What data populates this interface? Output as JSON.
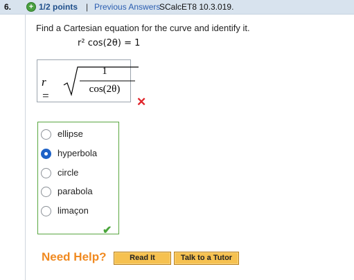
{
  "header": {
    "question_number": "6.",
    "plus_symbol": "+",
    "points": "1/2 points",
    "separator": "|",
    "previous_answers": "Previous Answers",
    "source": "SCalcET8 10.3.019."
  },
  "question": {
    "prompt": "Find a Cartesian equation for the curve and identify it.",
    "given_equation": "r² cos(2θ) = 1"
  },
  "answer": {
    "lhs": "r =",
    "numerator": "1",
    "denominator": "cos(2θ)",
    "status": "incorrect"
  },
  "choices": {
    "items": [
      {
        "label": "ellipse",
        "selected": false
      },
      {
        "label": "hyperbola",
        "selected": true
      },
      {
        "label": "circle",
        "selected": false
      },
      {
        "label": "parabola",
        "selected": false
      },
      {
        "label": "limaçon",
        "selected": false
      }
    ],
    "status": "correct"
  },
  "help": {
    "need_help": "Need Help?",
    "read_it": "Read It",
    "talk_to_tutor": "Talk to a Tutor"
  },
  "icons": {
    "incorrect": "x-icon",
    "correct": "checkmark-icon",
    "points_badge": "plus-circle-icon"
  },
  "colors": {
    "accent_orange": "#f08a21",
    "link_blue": "#2a5db0",
    "correct_green": "#49a53a",
    "incorrect_red": "#e0242a"
  }
}
